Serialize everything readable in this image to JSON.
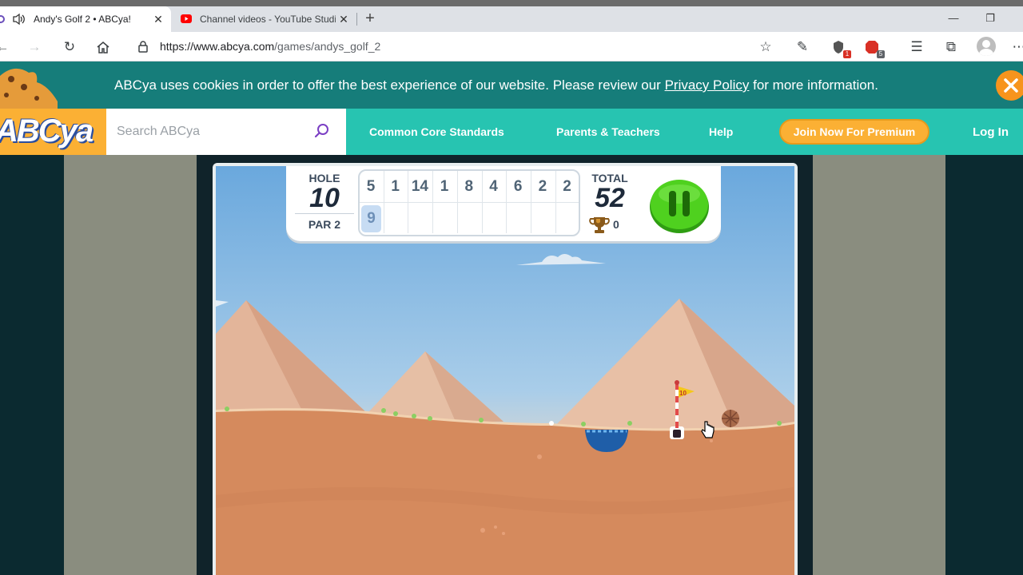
{
  "browser": {
    "tabs": [
      {
        "title": "Andy's Golf 2 • ABCya!",
        "active": true
      },
      {
        "title": "Channel videos - YouTube Studio",
        "active": false
      }
    ],
    "url_base": "https://www.abcya.com",
    "url_path": "/games/andys_golf_2",
    "extensions": [
      {
        "name": "shield-extension-icon",
        "badge": "1"
      },
      {
        "name": "adblock-extension-icon",
        "badge": "5"
      }
    ]
  },
  "cookie_banner": {
    "before": "ABCya uses cookies in order to offer the best experience of our website. Please review our ",
    "link": "Privacy Policy",
    "after": " for more information."
  },
  "nav": {
    "logo": "ABCya",
    "search_placeholder": "Search ABCya",
    "links": [
      "Common Core Standards",
      "Parents & Teachers",
      "Help"
    ],
    "premium": "Join Now For Premium",
    "login": "Log In"
  },
  "game": {
    "hole_label": "HOLE",
    "hole": "10",
    "par_label": "PAR 2",
    "scores": [
      "5",
      "1",
      "14",
      "1",
      "8",
      "4",
      "6",
      "2",
      "2",
      "9"
    ],
    "current_index": 9,
    "total_label": "TOTAL",
    "total": "52",
    "trophies": "0",
    "flag_number": "10"
  },
  "colors": {
    "cookie_bar": "#167d7a",
    "nav_bar": "#27c4b1",
    "accent": "#fbb034",
    "sky_top": "#6aa8dd",
    "sand": "#d58a5d",
    "pause_green": "#4fd11f"
  }
}
